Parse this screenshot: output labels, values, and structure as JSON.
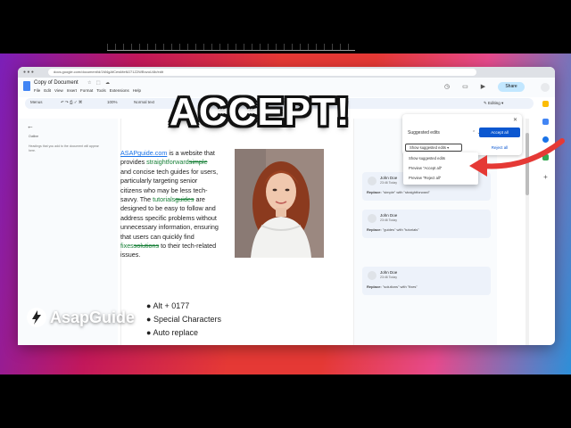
{
  "browser": {
    "url": "docs.google.com/document/d/1M4gAfCewMeMJ71Z2WBnzoU4b/edit"
  },
  "doc": {
    "title": "Copy of Document",
    "menu": [
      "File",
      "Edit",
      "View",
      "Insert",
      "Format",
      "Tools",
      "Extensions",
      "Help"
    ],
    "share_label": "Share"
  },
  "toolbar": {
    "menus": "Menus",
    "zoom": "100%",
    "style": "Normal text",
    "font": "Open...",
    "editing": "Editing"
  },
  "left_pane": {
    "outline": "Outline",
    "note": "Headings that you add to the document will appear here."
  },
  "document": {
    "link": "ASAPguide.com",
    "p1": " is a website that provides ",
    "ins1": "straightforward",
    "del1": "simple",
    "p2": " and concise tech guides for users, particularly targeting senior citizens who may be less tech-savvy. The ",
    "ins2": "tutorials",
    "del2": "guides",
    "p3": " are designed to  be easy to follow and address specific problems without unnecessary information, ensuring that users can quickly find ",
    "ins3": "fixes",
    "del3": "solutions",
    "p4": " to their tech-related issues.",
    "bullets": [
      "Alt + 0177",
      "Special Characters",
      "Auto replace"
    ]
  },
  "suggested_edits": {
    "title": "Suggested edits",
    "accept_all": "Accept all",
    "reject_all": "Reject all",
    "show_label": "Show suggested edits",
    "options": [
      "Show suggested edits",
      "Preview \"Accept all\"",
      "Preview \"Reject all\""
    ]
  },
  "cards": [
    {
      "name": "John Doe",
      "time": "23:46 Today",
      "action": "Replace:",
      "text": "\"simple\" with \"straightforward\""
    },
    {
      "name": "John Doe",
      "time": "23:46 Today",
      "action": "Replace:",
      "text": "\"guides\" with \"tutorials\""
    },
    {
      "name": "John Doe",
      "time": "23:46 Today",
      "action": "Replace:",
      "text": "\"solutions\" with \"fixes\""
    }
  ],
  "overlay": {
    "headline": "ACCEPT!",
    "brand": "AsapGuide"
  },
  "colors": {
    "accent": "#0b57d0",
    "suggestion": "#188038",
    "arrow": "#e53935"
  }
}
